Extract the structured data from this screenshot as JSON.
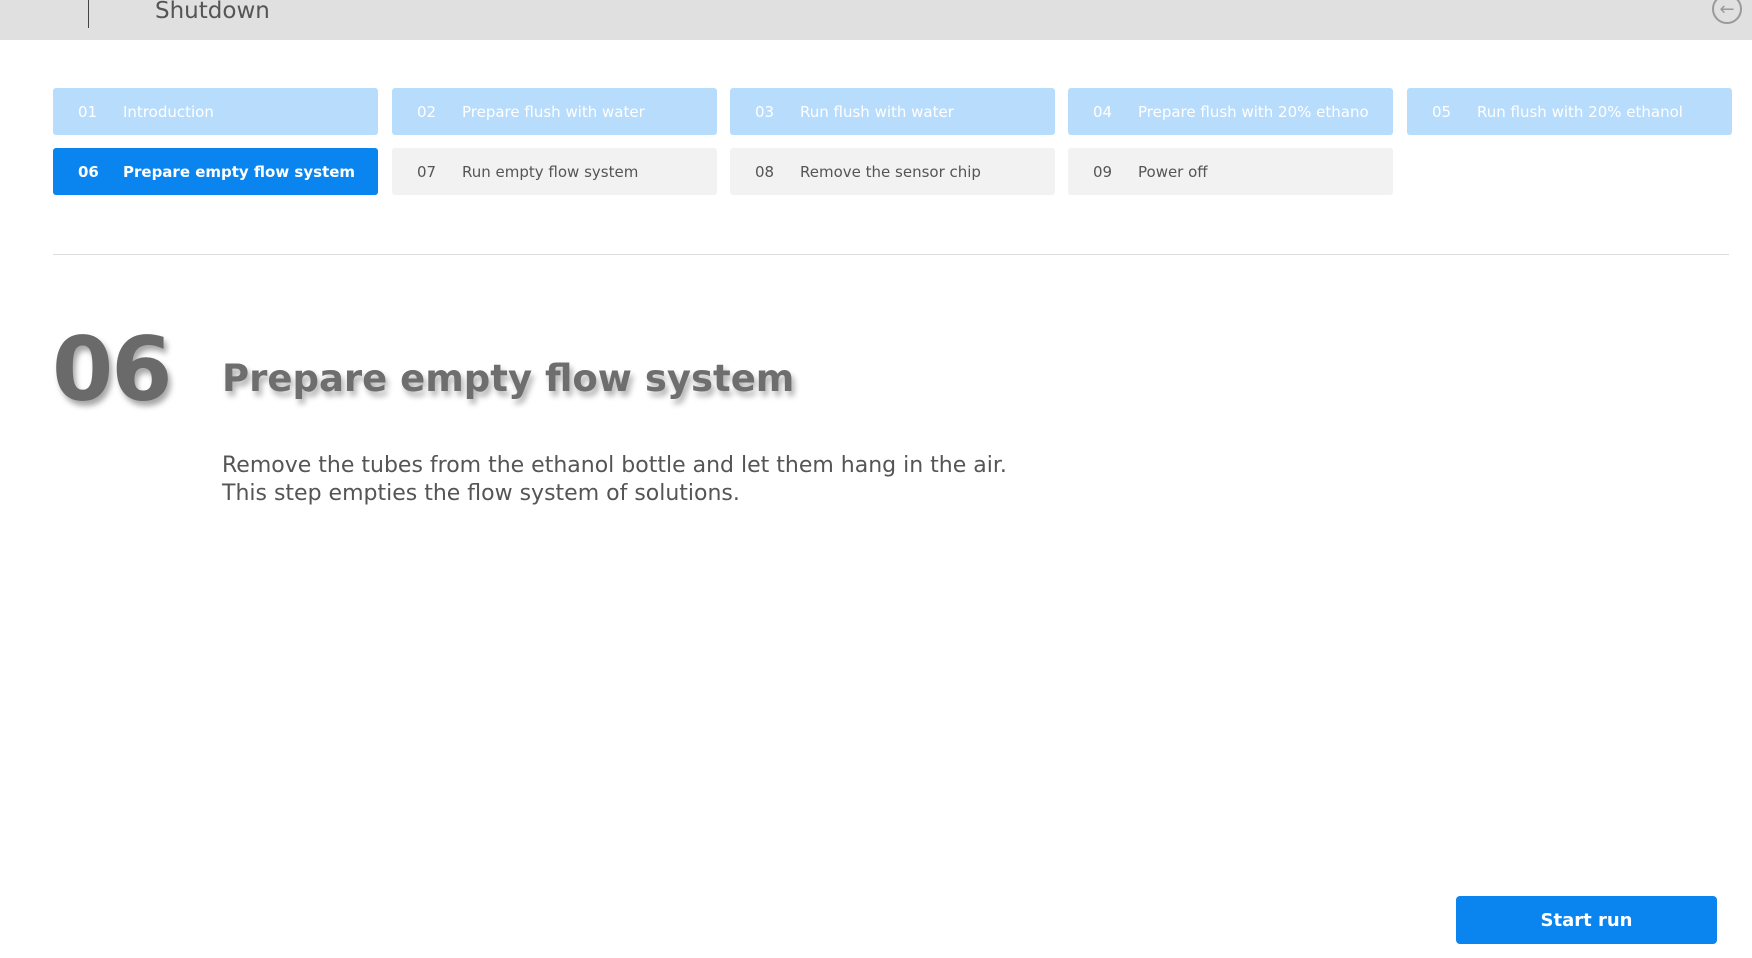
{
  "header": {
    "title": "Shutdown",
    "back_icon": "back-arrow-icon"
  },
  "steps": [
    {
      "num": "01",
      "label": "Introduction",
      "state": "done"
    },
    {
      "num": "02",
      "label": "Prepare flush with water",
      "state": "done"
    },
    {
      "num": "03",
      "label": "Run flush with water",
      "state": "done"
    },
    {
      "num": "04",
      "label": "Prepare flush with 20% ethano",
      "state": "done"
    },
    {
      "num": "05",
      "label": "Run flush with 20% ethanol",
      "state": "done"
    },
    {
      "num": "06",
      "label": "Prepare empty flow system",
      "state": "active"
    },
    {
      "num": "07",
      "label": "Run empty flow system",
      "state": "todo"
    },
    {
      "num": "08",
      "label": "Remove the sensor chip",
      "state": "todo"
    },
    {
      "num": "09",
      "label": "Power off",
      "state": "todo"
    }
  ],
  "current": {
    "number": "06",
    "title": "Prepare empty flow system",
    "description_line1": "Remove the tubes from the ethanol bottle and let them hang in the air.",
    "description_line2": "This step empties the flow system of solutions."
  },
  "actions": {
    "start_run": "Start run"
  },
  "colors": {
    "accent": "#0a84ee",
    "done": "#b8dcfb",
    "todo": "#f2f2f2"
  }
}
